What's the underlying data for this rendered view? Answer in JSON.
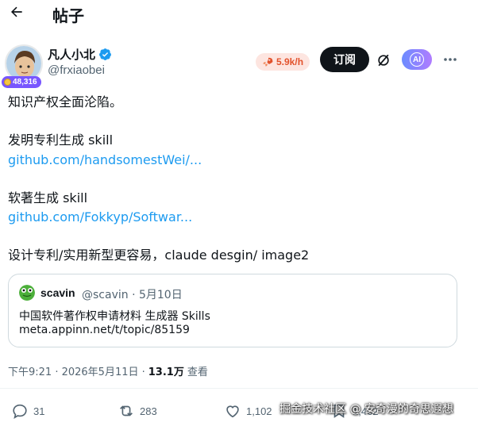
{
  "header": {
    "title": "帖子"
  },
  "author": {
    "name": "凡人小北",
    "handle": "@frxiaobei",
    "score_badge": "48,316",
    "speed": "5.9k/h"
  },
  "actions_top": {
    "subscribe_label": "订阅"
  },
  "post": {
    "line1": "知识产权全面沦陷。",
    "line2": "发明专利生成 skill",
    "link1": "github.com/handsomestWei/...",
    "line3": "软著生成 skill",
    "link2": "github.com/Fokkyp/Softwar...",
    "line4": "设计专利/实用新型更容易，claude desgin/ image2"
  },
  "quote": {
    "name": "scavin",
    "meta": "@scavin · 5月10日",
    "text": "中国软件著作权申请材料 生成器 Skills",
    "url": "meta.appinn.net/t/topic/85159"
  },
  "meta": {
    "timestamp": "下午9:21 · 2026年5月11日 ·",
    "views_count": "13.1万",
    "views_label": "查看"
  },
  "engagement": {
    "replies": "31",
    "reposts": "283",
    "likes": "1,102",
    "bookmarks": "1,462"
  },
  "watermark": "掘金技术社区 @ 安奇漫的奇思遐想",
  "colors": {
    "link": "#1d9bf0",
    "verified": "#1d9bf0",
    "badge": "#7856ff",
    "speed_bg": "#fde5e0",
    "speed_text": "#e2522c"
  }
}
